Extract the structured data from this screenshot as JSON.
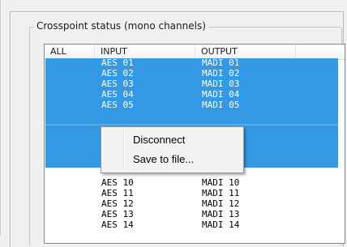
{
  "group_title": "Crosspoint status (mono channels)",
  "columns": [
    "ALL",
    "INPUT",
    "OUTPUT"
  ],
  "rows_selected": [
    {
      "input": "AES 01",
      "output": "MADI 01"
    },
    {
      "input": "AES 02",
      "output": "MADI 02"
    },
    {
      "input": "AES 03",
      "output": "MADI 03"
    },
    {
      "input": "AES 04",
      "output": "MADI 04"
    },
    {
      "input": "AES 05",
      "output": "MADI 05"
    }
  ],
  "rows_below": [
    {
      "input": "AES 10",
      "output": "MADI 10"
    },
    {
      "input": "AES 11",
      "output": "MADI 11"
    },
    {
      "input": "AES 12",
      "output": "MADI 12"
    },
    {
      "input": "AES 13",
      "output": "MADI 13"
    },
    {
      "input": "AES 14",
      "output": "MADI 14"
    }
  ],
  "context_menu": {
    "items": [
      "Disconnect",
      "Save to file..."
    ]
  },
  "colors": {
    "selection": "#3399e5",
    "selected_text": "#ffffff"
  }
}
